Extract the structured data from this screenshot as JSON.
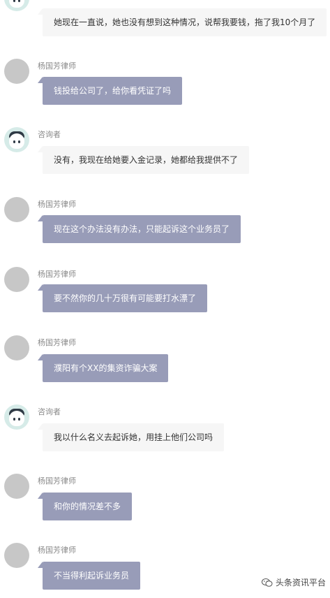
{
  "chat": {
    "messages": [
      {
        "role": "user",
        "sender": "",
        "text": "她现在一直说，她也没有想到这种情况，说帮我要钱，拖了我10个月了"
      },
      {
        "role": "lawyer",
        "sender": "杨国芳律师",
        "text": "钱投给公司了，给你看凭证了吗"
      },
      {
        "role": "user",
        "sender": "咨询者",
        "text": "没有，我现在给她要入金记录，她都给我提供不了"
      },
      {
        "role": "lawyer",
        "sender": "杨国芳律师",
        "text": "现在这个办法没有办法，只能起诉这个业务员了"
      },
      {
        "role": "lawyer",
        "sender": "杨国芳律师",
        "text": "要不然你的几十万很有可能要打水漂了"
      },
      {
        "role": "lawyer",
        "sender": "杨国芳律师",
        "text": "濮阳有个XX的集资诈骗大案"
      },
      {
        "role": "user",
        "sender": "咨询者",
        "text": "我以什么名义去起诉她，用挂上他们公司吗"
      },
      {
        "role": "lawyer",
        "sender": "杨国芳律师",
        "text": "和你的情况差不多"
      },
      {
        "role": "lawyer",
        "sender": "杨国芳律师",
        "text": "不当得利起诉业务员"
      }
    ]
  },
  "watermark": {
    "text": "头条资讯平台"
  },
  "colors": {
    "lawyer_bubble": "#989cb8",
    "user_bubble": "#f6f6f6",
    "lawyer_avatar": "#c7c7c7",
    "user_avatar": "#d6ebe8"
  }
}
